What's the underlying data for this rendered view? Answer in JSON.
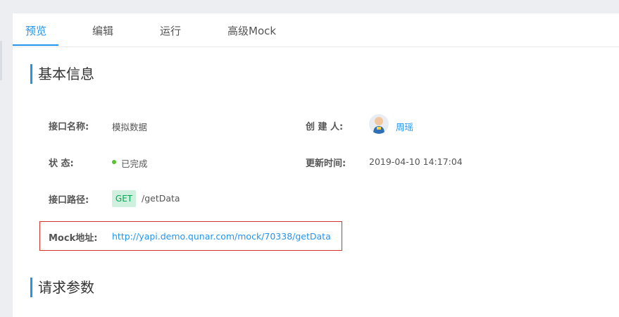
{
  "tabs": [
    {
      "label": "预览",
      "active": true
    },
    {
      "label": "编辑",
      "active": false
    },
    {
      "label": "运行",
      "active": false
    },
    {
      "label": "高级Mock",
      "active": false
    }
  ],
  "sections": {
    "basic_info": "基本信息",
    "request_params": "请求参数"
  },
  "fields": {
    "name_label": "接口名称:",
    "name_value": "模拟数据",
    "creator_label": "创 建 人:",
    "creator_value": "周瑶",
    "status_label": "状 态:",
    "status_value": "已完成",
    "updated_label": "更新时间:",
    "updated_value": "2019-04-10 14:17:04",
    "path_label": "接口路径:",
    "method": "GET",
    "path_value": "/getData",
    "mock_label": "Mock地址:",
    "mock_url": "http://yapi.demo.qunar.com/mock/70338/getData"
  },
  "colors": {
    "accent": "#2395f1",
    "status_done": "#57c22d",
    "get_tag_bg": "#cfefdf",
    "get_tag_text": "#00a854",
    "highlight_border": "#d0342c"
  }
}
